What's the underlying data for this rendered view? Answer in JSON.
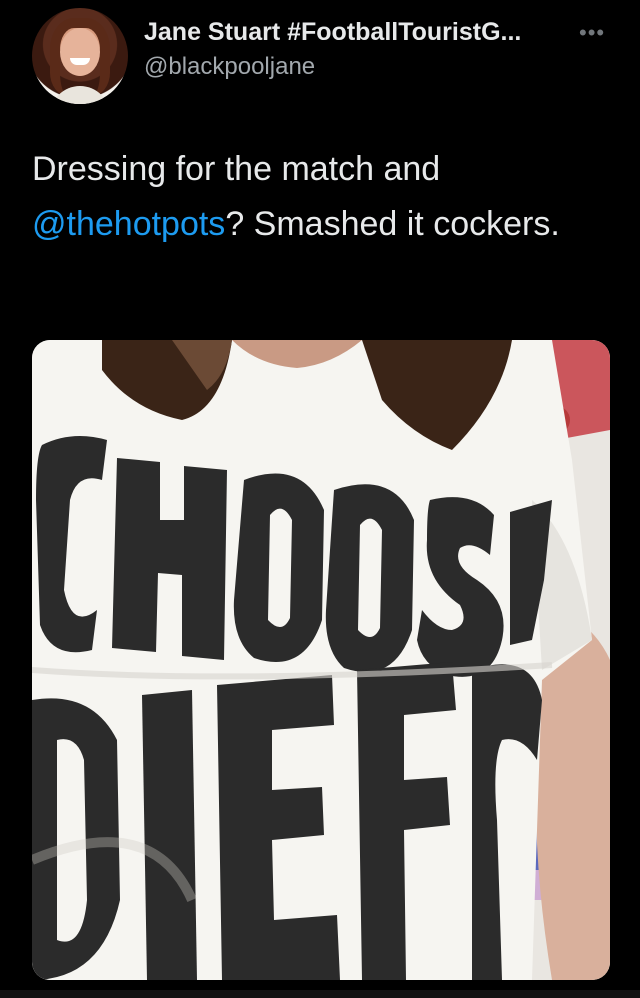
{
  "tweet": {
    "author_name": "Jane Stuart #FootballTouristG...",
    "author_handle": "@blackpooljane",
    "more_icon": "more-dots-icon",
    "text_parts": [
      "Dressing for the match and ",
      "@thehotpots",
      "? Smashed it cockers."
    ],
    "mention": "@thehotpots"
  },
  "media": {
    "description_icon": "photo",
    "tshirt_text_line1": "CHOOS",
    "tshirt_text_line2": "DIE"
  },
  "colors": {
    "background": "#000000",
    "text": "#e7e9ea",
    "secondary_text": "#71767b",
    "link": "#1d9bf0"
  }
}
